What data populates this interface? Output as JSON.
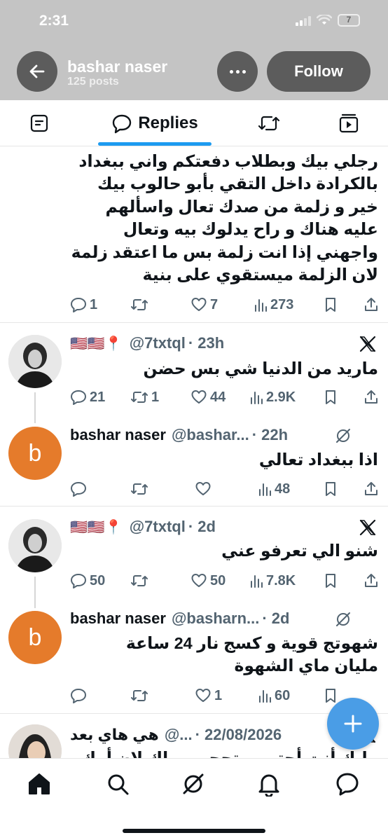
{
  "status_bar": {
    "time": "2:31",
    "battery": "7"
  },
  "header": {
    "name": "bashar naser",
    "posts": "125 posts",
    "follow_label": "Follow"
  },
  "tabs": {
    "active_label": "Replies"
  },
  "post1": {
    "lines": [
      "رجلي بيك وبطلاب دفعتكم واني ببغداد",
      "بالكرادة داخل التقي بأبو حالوب بيك",
      "خير و زلمة من صدك تعال واسألهم",
      "عليه هناك و راح يدلوك بيه وتعال",
      "واجهني إذا انت زلمة بس ما اعتقد زلمة",
      "لان الزلمة ميستقوي على بنية"
    ],
    "replies": "1",
    "retweets": "",
    "likes": "7",
    "views": "273"
  },
  "thread1": {
    "tweet": {
      "flags": "🇺🇸🇺🇸📍",
      "handle": "@7txtql",
      "time": "· 23h",
      "text": "ماريد من الدنيا شي بس حضن",
      "replies": "21",
      "retweets": "1",
      "likes": "44",
      "views": "2.9K"
    },
    "reply": {
      "avatar_letter": "b",
      "name": "bashar naser",
      "handle": "@bashar...",
      "time": "· 22h",
      "text": "اذا ببغداد تعالي",
      "replies": "",
      "retweets": "",
      "likes": "",
      "views": "48"
    }
  },
  "thread2": {
    "tweet": {
      "flags": "🇺🇸🇺🇸📍",
      "handle": "@7txtql",
      "time": "· 2d",
      "text": "شنو الي تعرفو عني",
      "replies": "50",
      "retweets": "",
      "likes": "50",
      "views": "7.8K"
    },
    "reply": {
      "avatar_letter": "b",
      "name": "bashar naser",
      "handle": "@basharn...",
      "time": "· 2d",
      "lines": [
        "شهوتج قوية و كسج نار 24 ساعة",
        "مليان ماي الشهوة"
      ],
      "replies": "",
      "retweets": "",
      "likes": "1",
      "views": "60"
    }
  },
  "post4": {
    "name": "هي هاي بعد",
    "handle": "@...",
    "time": "· 22/08/2026",
    "text": "مابك أنت أحتى ميتحجي وراك لان أمك"
  },
  "colors": {
    "accent": "#1d9bf0",
    "fab": "#4a9de6",
    "avatar_b": "#e57b2b",
    "header_bg": "#c4c4c4"
  }
}
